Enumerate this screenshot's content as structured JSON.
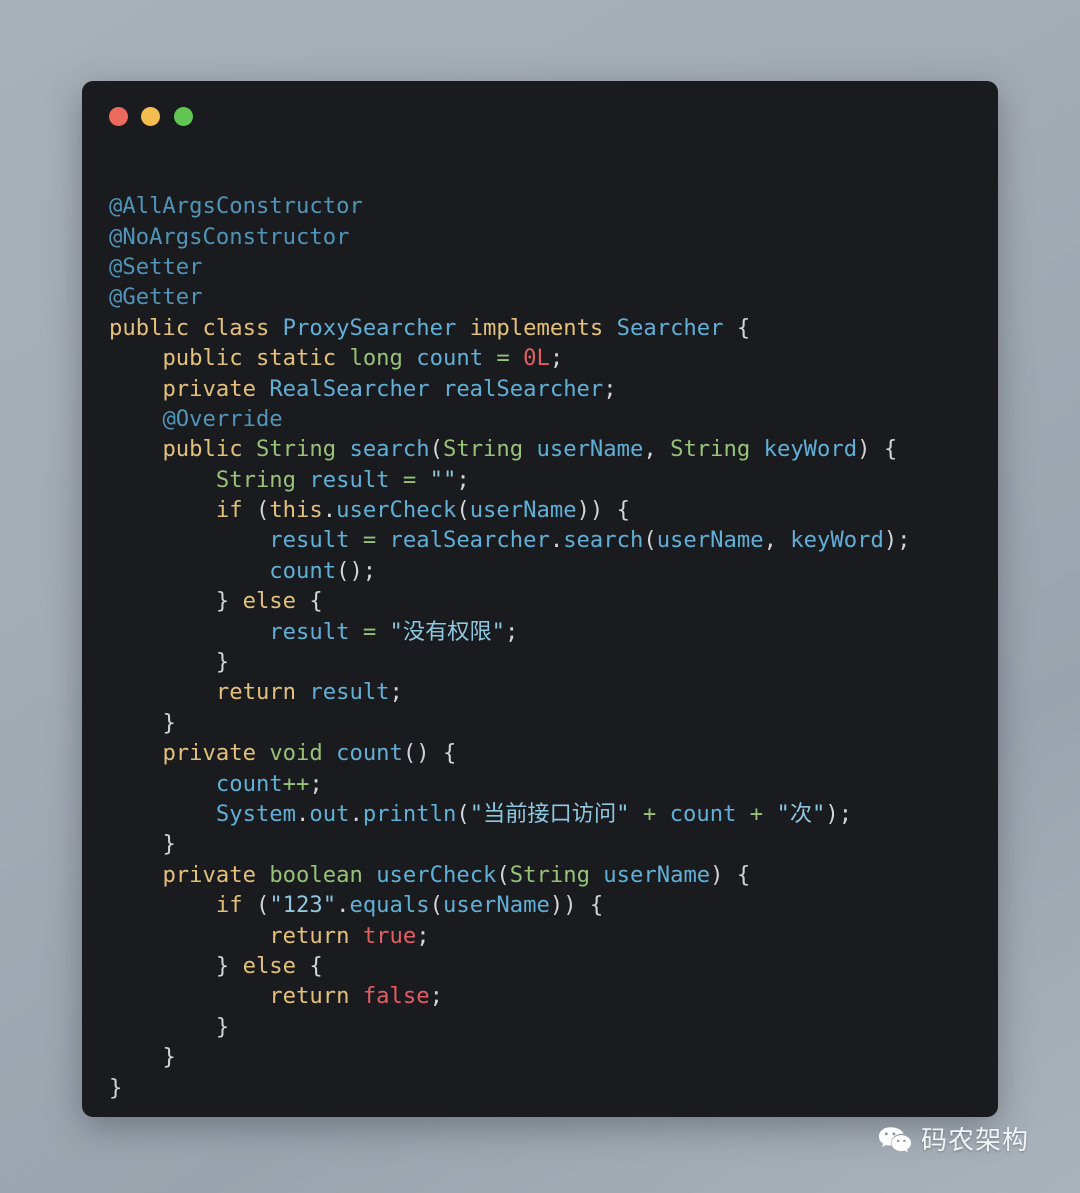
{
  "window": {
    "background_color": "#1a1b1e",
    "controls": [
      {
        "name": "close",
        "color": "#ec6a5e"
      },
      {
        "name": "minimize",
        "color": "#f4bd4f"
      },
      {
        "name": "zoom",
        "color": "#61c554"
      }
    ]
  },
  "theme": {
    "page_background": "#a6aeb8",
    "annotation": "#5294b8",
    "keyword": "#e3c07b",
    "type": "#97c279",
    "class_name": "#61afd7",
    "identifier": "#61afd7",
    "string": "#8ec7e0",
    "number": "#e05f65",
    "boolean": "#e05f65",
    "operator": "#97c279",
    "punctuation": "#d2d4d8"
  },
  "code": {
    "language": "java",
    "plain_text": "@AllArgsConstructor\n@NoArgsConstructor\n@Setter\n@Getter\npublic class ProxySearcher implements Searcher {\n    public static long count = 0L;\n    private RealSearcher realSearcher;\n    @Override\n    public String search(String userName, String keyWord) {\n        String result = \"\";\n        if (this.userCheck(userName)) {\n            result = realSearcher.search(userName, keyWord);\n            count();\n        } else {\n            result = \"没有权限\";\n        }\n        return result;\n    }\n    private void count() {\n        count++;\n        System.out.println(\"当前接口访问\" + count + \"次\");\n    }\n    private boolean userCheck(String userName) {\n        if (\"123\".equals(userName)) {\n            return true;\n        } else {\n            return false;\n        }\n    }\n}",
    "lines": [
      [
        {
          "t": "ann",
          "s": "@AllArgsConstructor"
        }
      ],
      [
        {
          "t": "ann",
          "s": "@NoArgsConstructor"
        }
      ],
      [
        {
          "t": "ann",
          "s": "@Setter"
        }
      ],
      [
        {
          "t": "ann",
          "s": "@Getter"
        }
      ],
      [
        {
          "t": "kw",
          "s": "public"
        },
        {
          "t": "plain",
          "s": " "
        },
        {
          "t": "kw",
          "s": "class"
        },
        {
          "t": "plain",
          "s": " "
        },
        {
          "t": "cls",
          "s": "ProxySearcher"
        },
        {
          "t": "plain",
          "s": " "
        },
        {
          "t": "kw",
          "s": "implements"
        },
        {
          "t": "plain",
          "s": " "
        },
        {
          "t": "cls",
          "s": "Searcher"
        },
        {
          "t": "punct",
          "s": " {"
        }
      ],
      [
        {
          "t": "plain",
          "s": "    "
        },
        {
          "t": "kw",
          "s": "public"
        },
        {
          "t": "plain",
          "s": " "
        },
        {
          "t": "kw",
          "s": "static"
        },
        {
          "t": "plain",
          "s": " "
        },
        {
          "t": "type",
          "s": "long"
        },
        {
          "t": "plain",
          "s": " "
        },
        {
          "t": "id",
          "s": "count"
        },
        {
          "t": "plain",
          "s": " "
        },
        {
          "t": "op",
          "s": "="
        },
        {
          "t": "plain",
          "s": " "
        },
        {
          "t": "num",
          "s": "0L"
        },
        {
          "t": "punct",
          "s": ";"
        }
      ],
      [
        {
          "t": "plain",
          "s": "    "
        },
        {
          "t": "kw",
          "s": "private"
        },
        {
          "t": "plain",
          "s": " "
        },
        {
          "t": "cls",
          "s": "RealSearcher"
        },
        {
          "t": "plain",
          "s": " "
        },
        {
          "t": "id",
          "s": "realSearcher"
        },
        {
          "t": "punct",
          "s": ";"
        }
      ],
      [
        {
          "t": "plain",
          "s": "    "
        },
        {
          "t": "ann",
          "s": "@Override"
        }
      ],
      [
        {
          "t": "plain",
          "s": "    "
        },
        {
          "t": "kw",
          "s": "public"
        },
        {
          "t": "plain",
          "s": " "
        },
        {
          "t": "type",
          "s": "String"
        },
        {
          "t": "plain",
          "s": " "
        },
        {
          "t": "fn",
          "s": "search"
        },
        {
          "t": "punct",
          "s": "("
        },
        {
          "t": "type",
          "s": "String"
        },
        {
          "t": "plain",
          "s": " "
        },
        {
          "t": "id",
          "s": "userName"
        },
        {
          "t": "punct",
          "s": ", "
        },
        {
          "t": "type",
          "s": "String"
        },
        {
          "t": "plain",
          "s": " "
        },
        {
          "t": "id",
          "s": "keyWord"
        },
        {
          "t": "punct",
          "s": ") {"
        }
      ],
      [
        {
          "t": "plain",
          "s": "        "
        },
        {
          "t": "type",
          "s": "String"
        },
        {
          "t": "plain",
          "s": " "
        },
        {
          "t": "id",
          "s": "result"
        },
        {
          "t": "plain",
          "s": " "
        },
        {
          "t": "op",
          "s": "="
        },
        {
          "t": "plain",
          "s": " "
        },
        {
          "t": "str",
          "s": "\"\""
        },
        {
          "t": "punct",
          "s": ";"
        }
      ],
      [
        {
          "t": "plain",
          "s": "        "
        },
        {
          "t": "kw",
          "s": "if"
        },
        {
          "t": "punct",
          "s": " ("
        },
        {
          "t": "kw",
          "s": "this"
        },
        {
          "t": "punct",
          "s": "."
        },
        {
          "t": "fn",
          "s": "userCheck"
        },
        {
          "t": "punct",
          "s": "("
        },
        {
          "t": "id",
          "s": "userName"
        },
        {
          "t": "punct",
          "s": ")) {"
        }
      ],
      [
        {
          "t": "plain",
          "s": "            "
        },
        {
          "t": "id",
          "s": "result"
        },
        {
          "t": "plain",
          "s": " "
        },
        {
          "t": "op",
          "s": "="
        },
        {
          "t": "plain",
          "s": " "
        },
        {
          "t": "id",
          "s": "realSearcher"
        },
        {
          "t": "punct",
          "s": "."
        },
        {
          "t": "fn",
          "s": "search"
        },
        {
          "t": "punct",
          "s": "("
        },
        {
          "t": "id",
          "s": "userName"
        },
        {
          "t": "punct",
          "s": ", "
        },
        {
          "t": "id",
          "s": "keyWord"
        },
        {
          "t": "punct",
          "s": ");"
        }
      ],
      [
        {
          "t": "plain",
          "s": "            "
        },
        {
          "t": "fn",
          "s": "count"
        },
        {
          "t": "punct",
          "s": "();"
        }
      ],
      [
        {
          "t": "plain",
          "s": "        "
        },
        {
          "t": "punct",
          "s": "} "
        },
        {
          "t": "kw",
          "s": "else"
        },
        {
          "t": "punct",
          "s": " {"
        }
      ],
      [
        {
          "t": "plain",
          "s": "            "
        },
        {
          "t": "id",
          "s": "result"
        },
        {
          "t": "plain",
          "s": " "
        },
        {
          "t": "op",
          "s": "="
        },
        {
          "t": "plain",
          "s": " "
        },
        {
          "t": "str",
          "s": "\"没有权限\""
        },
        {
          "t": "punct",
          "s": ";"
        }
      ],
      [
        {
          "t": "plain",
          "s": "        "
        },
        {
          "t": "punct",
          "s": "}"
        }
      ],
      [
        {
          "t": "plain",
          "s": "        "
        },
        {
          "t": "kw",
          "s": "return"
        },
        {
          "t": "plain",
          "s": " "
        },
        {
          "t": "id",
          "s": "result"
        },
        {
          "t": "punct",
          "s": ";"
        }
      ],
      [
        {
          "t": "plain",
          "s": "    "
        },
        {
          "t": "punct",
          "s": "}"
        }
      ],
      [
        {
          "t": "plain",
          "s": "    "
        },
        {
          "t": "kw",
          "s": "private"
        },
        {
          "t": "plain",
          "s": " "
        },
        {
          "t": "type",
          "s": "void"
        },
        {
          "t": "plain",
          "s": " "
        },
        {
          "t": "fn",
          "s": "count"
        },
        {
          "t": "punct",
          "s": "() {"
        }
      ],
      [
        {
          "t": "plain",
          "s": "        "
        },
        {
          "t": "id",
          "s": "count"
        },
        {
          "t": "op",
          "s": "++"
        },
        {
          "t": "punct",
          "s": ";"
        }
      ],
      [
        {
          "t": "plain",
          "s": "        "
        },
        {
          "t": "cls",
          "s": "System"
        },
        {
          "t": "punct",
          "s": "."
        },
        {
          "t": "id",
          "s": "out"
        },
        {
          "t": "punct",
          "s": "."
        },
        {
          "t": "fn",
          "s": "println"
        },
        {
          "t": "punct",
          "s": "("
        },
        {
          "t": "str",
          "s": "\"当前接口访问\""
        },
        {
          "t": "plain",
          "s": " "
        },
        {
          "t": "op",
          "s": "+"
        },
        {
          "t": "plain",
          "s": " "
        },
        {
          "t": "id",
          "s": "count"
        },
        {
          "t": "plain",
          "s": " "
        },
        {
          "t": "op",
          "s": "+"
        },
        {
          "t": "plain",
          "s": " "
        },
        {
          "t": "str",
          "s": "\"次\""
        },
        {
          "t": "punct",
          "s": ");"
        }
      ],
      [
        {
          "t": "plain",
          "s": "    "
        },
        {
          "t": "punct",
          "s": "}"
        }
      ],
      [
        {
          "t": "plain",
          "s": "    "
        },
        {
          "t": "kw",
          "s": "private"
        },
        {
          "t": "plain",
          "s": " "
        },
        {
          "t": "type",
          "s": "boolean"
        },
        {
          "t": "plain",
          "s": " "
        },
        {
          "t": "fn",
          "s": "userCheck"
        },
        {
          "t": "punct",
          "s": "("
        },
        {
          "t": "type",
          "s": "String"
        },
        {
          "t": "plain",
          "s": " "
        },
        {
          "t": "id",
          "s": "userName"
        },
        {
          "t": "punct",
          "s": ") {"
        }
      ],
      [
        {
          "t": "plain",
          "s": "        "
        },
        {
          "t": "kw",
          "s": "if"
        },
        {
          "t": "punct",
          "s": " ("
        },
        {
          "t": "str",
          "s": "\"123\""
        },
        {
          "t": "punct",
          "s": "."
        },
        {
          "t": "fn",
          "s": "equals"
        },
        {
          "t": "punct",
          "s": "("
        },
        {
          "t": "id",
          "s": "userName"
        },
        {
          "t": "punct",
          "s": ")) {"
        }
      ],
      [
        {
          "t": "plain",
          "s": "            "
        },
        {
          "t": "kw",
          "s": "return"
        },
        {
          "t": "plain",
          "s": " "
        },
        {
          "t": "bool",
          "s": "true"
        },
        {
          "t": "punct",
          "s": ";"
        }
      ],
      [
        {
          "t": "plain",
          "s": "        "
        },
        {
          "t": "punct",
          "s": "} "
        },
        {
          "t": "kw",
          "s": "else"
        },
        {
          "t": "punct",
          "s": " {"
        }
      ],
      [
        {
          "t": "plain",
          "s": "            "
        },
        {
          "t": "kw",
          "s": "return"
        },
        {
          "t": "plain",
          "s": " "
        },
        {
          "t": "bool",
          "s": "false"
        },
        {
          "t": "punct",
          "s": ";"
        }
      ],
      [
        {
          "t": "plain",
          "s": "        "
        },
        {
          "t": "punct",
          "s": "}"
        }
      ],
      [
        {
          "t": "plain",
          "s": "    "
        },
        {
          "t": "punct",
          "s": "}"
        }
      ],
      [
        {
          "t": "punct",
          "s": "}"
        }
      ]
    ]
  },
  "watermark": {
    "icon": "wechat-icon",
    "text": "码农架构"
  }
}
